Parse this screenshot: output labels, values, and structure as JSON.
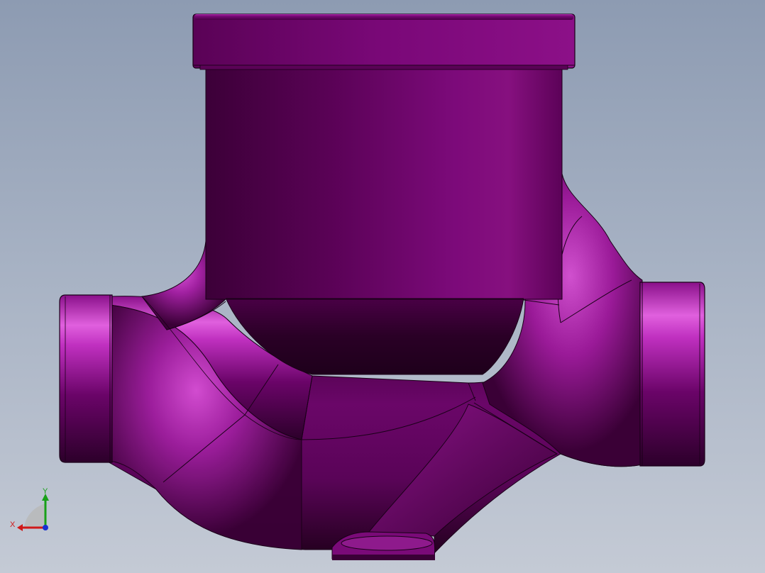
{
  "viewport": {
    "model_color": "#7a0a78",
    "highlight_color": "#e25ee0",
    "shadow_color": "#2a0028",
    "edge_color": "#1a0018",
    "background_top": "#8d9bb2",
    "background_bottom": "#c4cad5"
  },
  "triad": {
    "x_label": "X",
    "y_label": "Y",
    "x_color": "#d01818",
    "y_color": "#18a018",
    "z_color": "#1830d0"
  }
}
